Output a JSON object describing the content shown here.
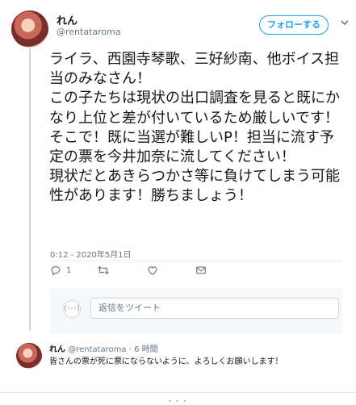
{
  "tweet": {
    "author_name": "れん",
    "author_handle": "@rentataroma",
    "follow_label": "フォローする",
    "text": "ライラ、西園寺琴歌、三好紗南、他ボイス担当のみなさん！\nこの子たちは現状の出口調査を見ると既にかなり上位と差が付いているため厳しいです！\nそこで！既に当選が難しいP！担当に流す予定の票を今井加奈に流してください！\n現状だとあきらつかさ等に負けてしまう可能性があります！勝ちましょう！",
    "timestamp": "0:12 - 2020年5月1日",
    "reply_count": "1"
  },
  "reply_box": {
    "avatar_glyph": "(･-･)",
    "placeholder": "返信をツイート"
  },
  "reply": {
    "author_name": "れん",
    "author_handle": "@rentataroma",
    "separator": "·",
    "time_ago": "6 時間",
    "text": "皆さんの票が死に票にならないように、よろしくお願いします！"
  },
  "footer": {
    "dots": "• • •"
  },
  "colors": {
    "accent": "#1da1f2",
    "muted": "#657786",
    "border": "#e6ecf0"
  },
  "icons": [
    "chevron-down-icon",
    "reply-icon",
    "retweet-icon",
    "like-icon",
    "dm-icon"
  ]
}
